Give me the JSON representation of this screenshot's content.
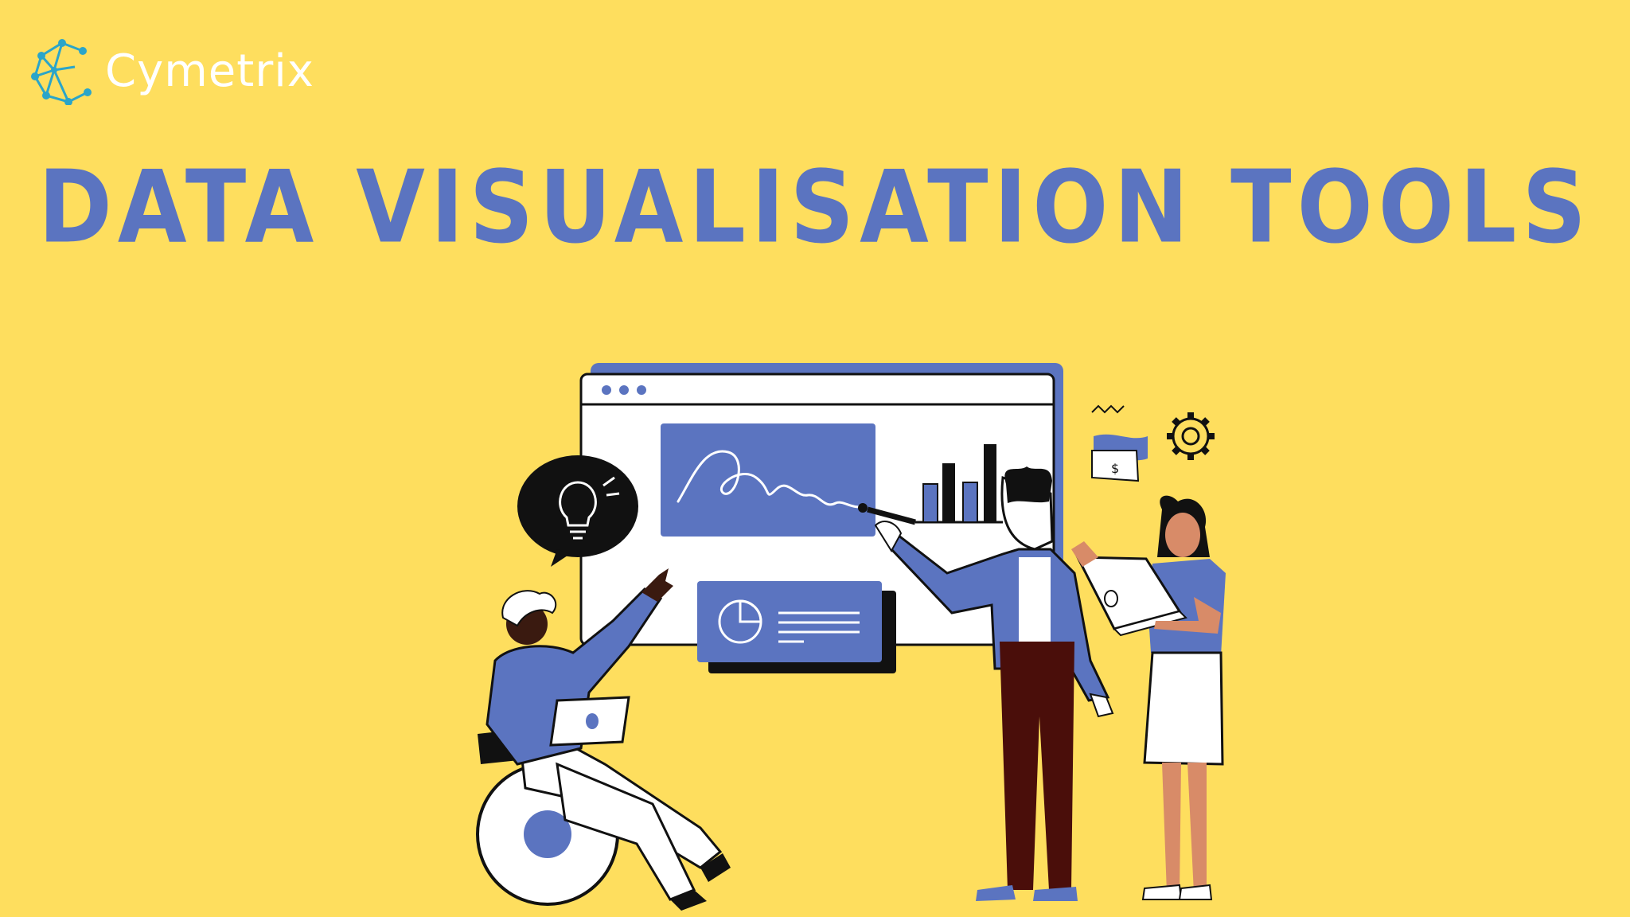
{
  "brand": {
    "name": "Cymetrix",
    "logo_icon": "network-c-icon",
    "color": "#ffffff",
    "icon_color": "#2BA5C9"
  },
  "title": {
    "text": "DATA VISUALISATION TOOLS",
    "color": "#5B74C0"
  },
  "colors": {
    "background": "#FEDE5E",
    "accent_blue": "#5B74C0",
    "dark": "#111111",
    "skin_dark": "#3a1a10",
    "skin_light": "#D88B68",
    "trousers": "#4A0E0A"
  },
  "illustration": {
    "icons": [
      "lightbulb-icon",
      "gear-icon",
      "money-flag-icon",
      "bar-chart-icon",
      "pie-chart-icon",
      "signature-icon"
    ]
  }
}
